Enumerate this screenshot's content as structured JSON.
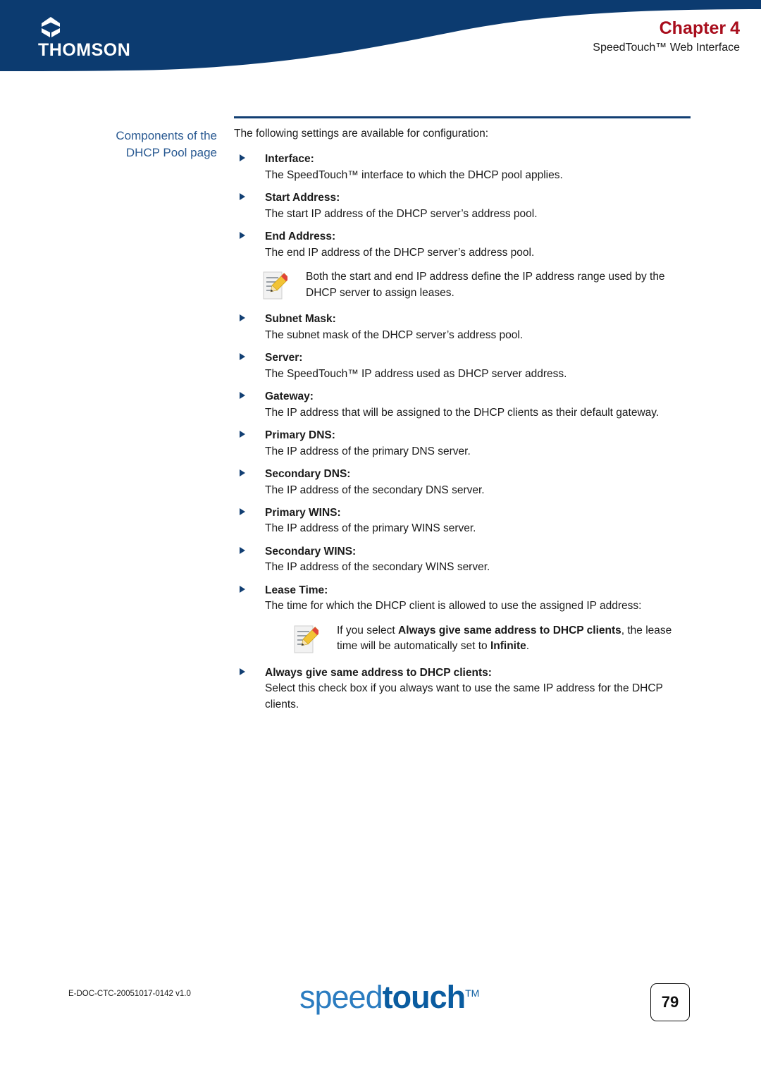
{
  "header": {
    "brand": "THOMSON",
    "brand_mark_icon": "thomson-diamond-logo-icon",
    "chapter_label": "Chapter",
    "chapter_number": "4",
    "subtitle": "SpeedTouch™ Web Interface",
    "band_color": "#0c3b70",
    "chapter_color": "#a80d1c"
  },
  "sidebar": {
    "heading_line1": "Components of the",
    "heading_line2": "DHCP Pool page",
    "heading_color": "#2a5a92"
  },
  "main": {
    "rule_color": "#123f73",
    "intro": "The following settings are available for configuration:",
    "items": [
      {
        "term": "Interface",
        "colon": ":",
        "desc": "The SpeedTouch™ interface to which the DHCP pool applies."
      },
      {
        "term": "Start Address",
        "colon": ":",
        "desc": "The start IP address of the DHCP server’s address pool."
      },
      {
        "term": "End Address",
        "colon": ":",
        "desc": "The end IP address of the DHCP server’s address pool."
      },
      {
        "term": "Subnet Mask",
        "colon": ":",
        "desc": "The subnet mask of the DHCP server’s address pool."
      },
      {
        "term": "Server",
        "colon": ":",
        "desc": "The SpeedTouch™ IP address used as DHCP server address."
      },
      {
        "term": "Gateway",
        "colon": ":",
        "desc": "The IP address that will be assigned to the DHCP clients as their default gateway."
      },
      {
        "term": "Primary DNS",
        "colon": ":",
        "desc": "The IP address of the primary DNS server."
      },
      {
        "term": "Secondary DNS",
        "colon": ":",
        "desc": "The IP address of the secondary DNS server."
      },
      {
        "term": "Primary WINS",
        "colon": ":",
        "desc": "The IP address of the primary WINS server."
      },
      {
        "term": "Secondary WINS",
        "colon": ":",
        "desc": "The IP address of the secondary WINS server."
      },
      {
        "term": "Lease Time",
        "colon": ":",
        "desc": "The time for which the DHCP client is allowed to use the assigned IP address:"
      },
      {
        "term": "Always give same address to DHCP clients",
        "colon": ":",
        "desc": "Select this check box if you always want to use the same IP address for the DHCP clients."
      }
    ],
    "note_1": {
      "icon": "note-pencil-icon",
      "text": "Both the start and end IP address define the IP address range used by the DHCP server to assign leases."
    },
    "note_2": {
      "icon": "note-pencil-icon",
      "part1": "If you select ",
      "bold1": "Always give same address to DHCP clients",
      "part2": ", the lease time will be automatically set to ",
      "bold2": "Infinite",
      "part3": "."
    }
  },
  "footer": {
    "doc_id": "E-DOC-CTC-20051017-0142 v1.0",
    "logo_part_a": "speed",
    "logo_part_b": "touch",
    "logo_tm": "TM",
    "page_number": "79"
  }
}
